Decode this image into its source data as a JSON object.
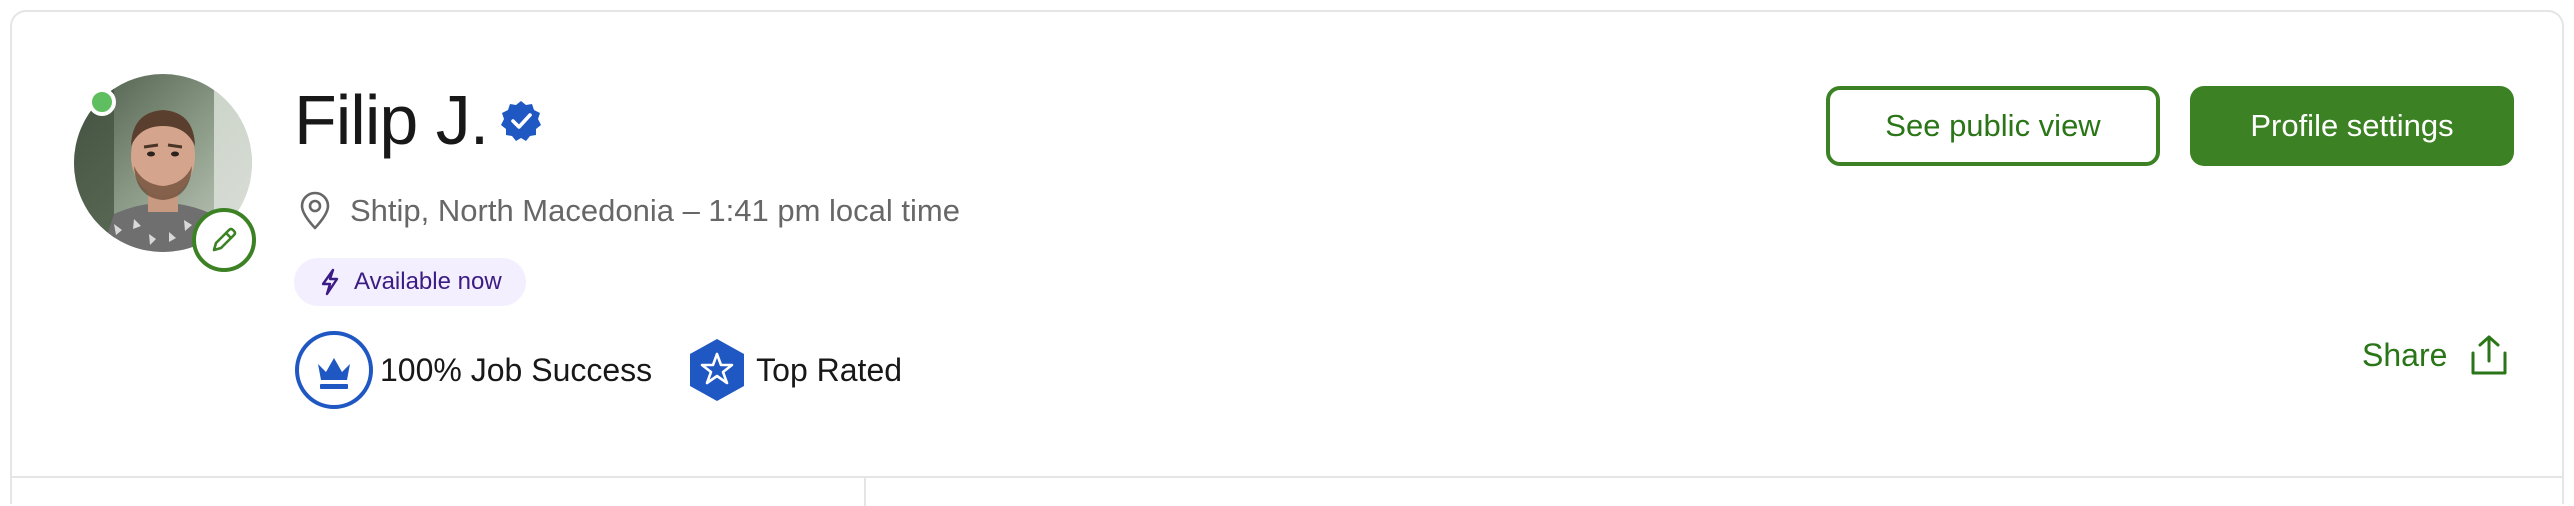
{
  "profile": {
    "name": "Filip J.",
    "location": "Shtip, North Macedonia – 1:41 pm local time",
    "availability": "Available now"
  },
  "badges": {
    "job_success": "100% Job Success",
    "top_rated": "Top Rated"
  },
  "actions": {
    "public_view": "See public view",
    "settings": "Profile settings",
    "share": "Share"
  },
  "colors": {
    "brand_green": "#3c8224",
    "online_dot": "#5fbe5f",
    "verified_blue": "#1f57c3",
    "availability_bg": "#f4efff",
    "availability_text": "#3b1b84"
  },
  "icons": [
    "online-status-dot",
    "edit-pencil-icon",
    "verified-badge-icon",
    "location-pin-icon",
    "lightning-bolt-icon",
    "crown-icon",
    "star-hexagon-icon",
    "share-upload-icon"
  ]
}
